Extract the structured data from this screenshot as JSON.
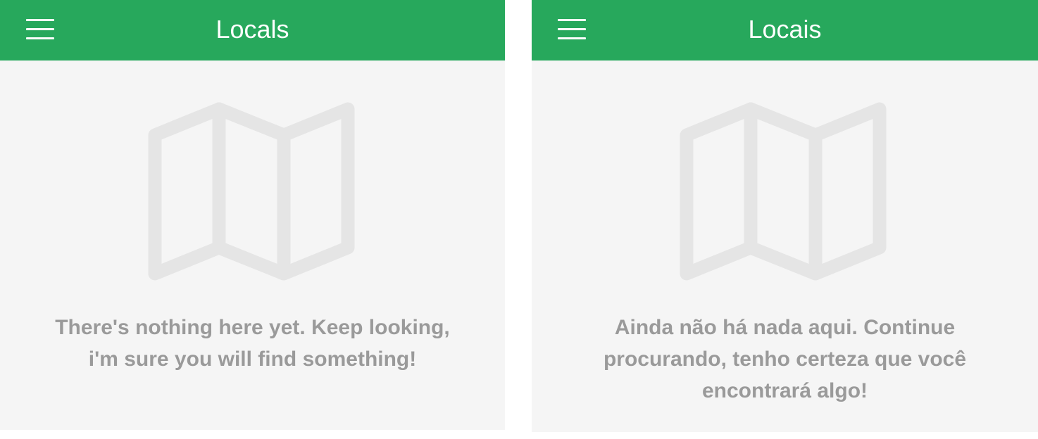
{
  "screens": [
    {
      "title": "Locals",
      "menu_icon": "hamburger-menu-icon",
      "empty_icon": "folded-map-icon",
      "empty_message": "There's nothing here yet. Keep looking, i'm sure you will find something!"
    },
    {
      "title": "Locais",
      "menu_icon": "hamburger-menu-icon",
      "empty_icon": "folded-map-icon",
      "empty_message": "Ainda não há nada aqui. Continue procurando, tenho certeza que você encontrará algo!"
    }
  ],
  "colors": {
    "app_bar": "#27a85c",
    "background": "#f5f5f5",
    "empty_text": "#9a9a9a",
    "empty_icon": "#e5e5e5"
  }
}
